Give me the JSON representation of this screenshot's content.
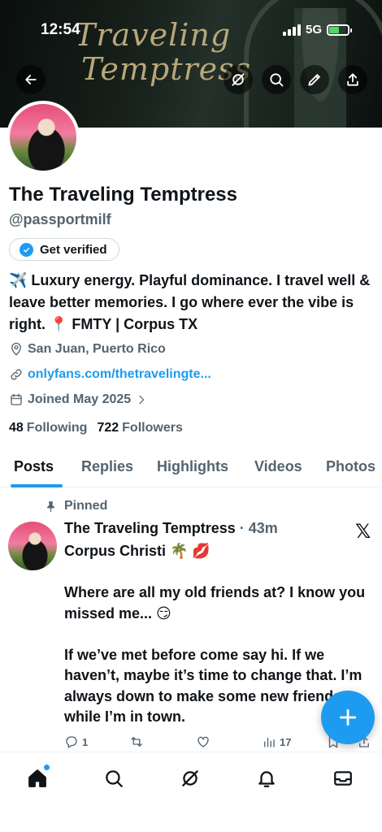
{
  "status_bar": {
    "time": "12:54",
    "network": "5G"
  },
  "banner": {
    "title_line1": "Traveling",
    "title_line2": "Temptress"
  },
  "profile": {
    "name": "The Traveling Temptress",
    "handle": "@passportmilf",
    "get_verified_label": "Get verified",
    "bio": "✈️ Luxury energy. Playful dominance. I travel well & leave better memories. I go where ever the vibe is right. 📍 FMTY | Corpus TX",
    "location": "San Juan, Puerto Rico",
    "website": "onlyfans.com/thetravelingte...",
    "joined": "Joined May 2025",
    "following_count": "48",
    "following_label": "Following",
    "followers_count": "722",
    "followers_label": "Followers"
  },
  "tabs": [
    "Posts",
    "Replies",
    "Highlights",
    "Videos",
    "Photos"
  ],
  "post": {
    "pinned_label": "Pinned",
    "author": "The Traveling Temptress",
    "separator": " · ",
    "time": "43m",
    "text": "Corpus Christi 🌴 💋\n\nWhere are all my old friends at? I know you missed me... 😏\n\nIf we’ve met before come say hi. If we haven’t, maybe it’s time to change that. I’m always down to make some new friends while I’m in town.",
    "replies": "1",
    "views": "17",
    "source_logo": "𝕏"
  },
  "colors": {
    "accent": "#1d9bf0",
    "text": "#0f1419",
    "secondary": "#536471"
  },
  "icons": [
    "back-arrow-icon",
    "grok-icon",
    "search-icon",
    "edit-icon",
    "share-icon",
    "checkmark-badge-icon",
    "location-icon",
    "link-icon",
    "calendar-icon",
    "chevron-right-icon",
    "pin-icon",
    "x-logo-icon",
    "reply-icon",
    "retweet-icon",
    "like-icon",
    "views-icon",
    "bookmark-icon",
    "plus-icon",
    "home-icon",
    "notifications-icon",
    "messages-icon"
  ]
}
